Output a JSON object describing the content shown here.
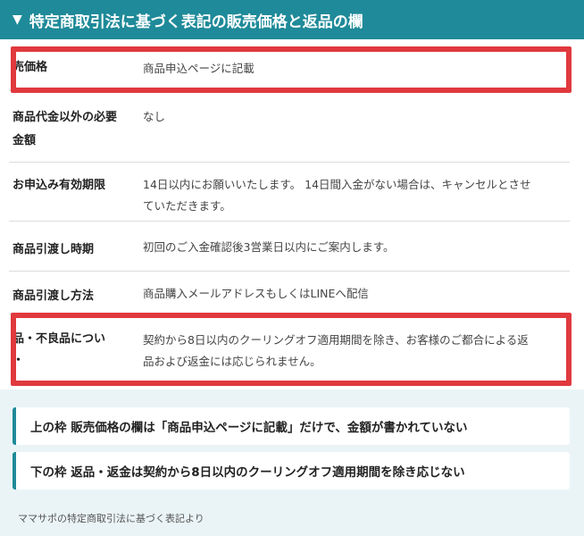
{
  "header": {
    "arrow": "▼",
    "title": "特定商取引法に基づく表記の販売価格と返品の欄"
  },
  "rows": [
    {
      "label": "売価格",
      "value": "商品申込ページに記載"
    },
    {
      "label": "商品代金以外の必要",
      "label2": "金額",
      "value": "なし"
    },
    {
      "label": "お申込み有効期限",
      "value": "14日以内にお願いいたします。 14日間入金がない場合は、キャンセルとさせ",
      "value2": "ていただきます。"
    },
    {
      "label": "商品引渡し時期",
      "value": "初回のご入金確認後3営業日以内にご案内します。"
    },
    {
      "label": "商品引渡し方法",
      "value": "商品購入メールアドレスもしくはLINEへ配信"
    },
    {
      "label": "品・不良品につい",
      "label2": "・",
      "value": "契約から8日以内のクーリングオフ適用期間を除き、お客様のご都合による返",
      "value2": "品および返金には応じられません。"
    }
  ],
  "notes": [
    "上の枠 販売価格の欄は「商品申込ページに記載」だけで、金額が書かれていない",
    "下の枠 返品・返金は契約から8日以内のクーリングオフ適用期間を除き応じない"
  ],
  "caption": "ママサポの特定商取引法に基づく表記より",
  "colors": {
    "header": "#1f8a99",
    "highlight": "#e0393e",
    "notes_bg": "#eaf4f6"
  }
}
